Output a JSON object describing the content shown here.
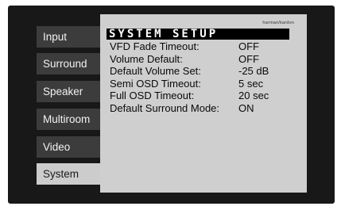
{
  "brand": "harman/kardon",
  "menu": {
    "items": [
      {
        "label": "Input",
        "active": false
      },
      {
        "label": "Surround",
        "active": false
      },
      {
        "label": "Speaker",
        "active": false
      },
      {
        "label": "Multiroom",
        "active": false
      },
      {
        "label": "Video",
        "active": false
      },
      {
        "label": "System",
        "active": true
      }
    ]
  },
  "panel": {
    "title": "SYSTEM SETUP",
    "settings": [
      {
        "label": "VFD Fade Timeout:",
        "value": "OFF"
      },
      {
        "label": "Volume Default:",
        "value": "OFF"
      },
      {
        "label": "Default Volume Set:",
        "value": "-25 dB"
      },
      {
        "label": "Semi OSD Timeout:",
        "value": "5 sec"
      },
      {
        "label": "Full OSD Timeout:",
        "value": "20 sec"
      },
      {
        "label": "Default Surround Mode:",
        "value": "ON"
      }
    ]
  },
  "colors": {
    "bezel": "#181818",
    "tab": "#3c3c3c",
    "active_tab": "#cccccc",
    "panel": "#cfcfcf",
    "title_bar": "#000000"
  }
}
